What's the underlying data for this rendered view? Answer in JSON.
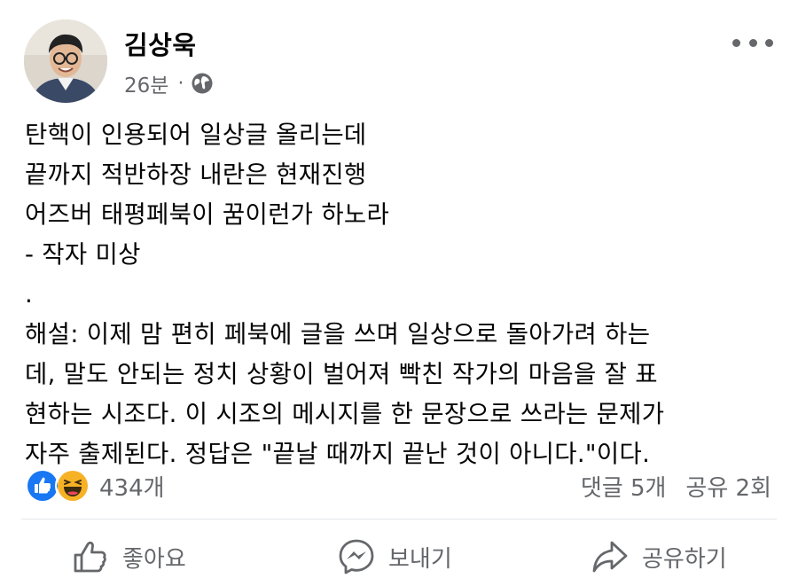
{
  "post": {
    "author": "김상욱",
    "time": "26분",
    "separator": "·",
    "privacy_icon": "globe-icon",
    "lines": [
      "탄핵이 인용되어 일상글 올리는데",
      "끝까지 적반하장 내란은 현재진행",
      "어즈버 태평페북이 꿈이런가 하노라",
      "- 작자 미상",
      ".",
      "해설: 이제 맘 편히 페북에 글을 쓰며 일상으로 돌아가려 하는",
      "데, 말도 안되는 정치 상황이 벌어져 빡친 작가의 마음을 잘 표",
      "현하는 시조다. 이 시조의 메시지를 한 문장으로 쓰라는 문제가",
      "자주 출제된다. 정답은 \"끝날 때까지 끝난 것이 아니다.\"이다."
    ]
  },
  "stats": {
    "reaction_icons": [
      "like-icon",
      "haha-icon"
    ],
    "reaction_count": "434개",
    "comments": "댓글 5개",
    "shares": "공유 2회"
  },
  "actions": {
    "like_label": "좋아요",
    "send_label": "보내기",
    "share_label": "공유하기"
  },
  "colors": {
    "like_blue": "#1877f2",
    "haha_yellow": "#f7b125",
    "secondary_text": "#65676b"
  }
}
